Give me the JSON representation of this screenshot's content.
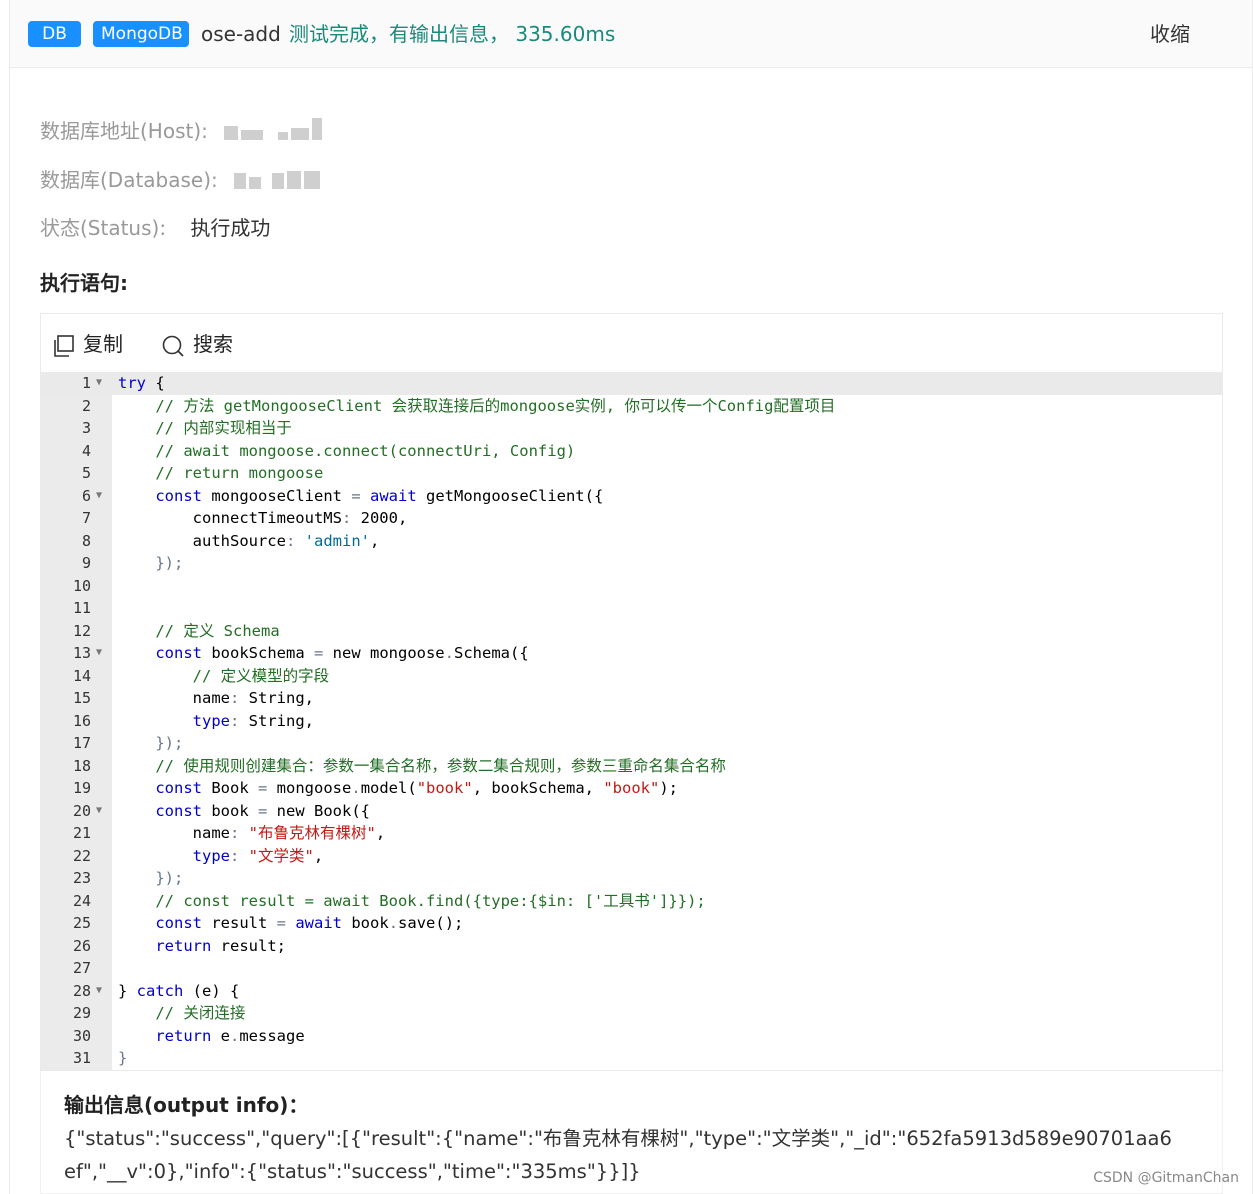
{
  "header": {
    "tag_db": "DB",
    "tag_mongo": "MongoDB",
    "name": "ose-add",
    "status_text": "测试完成，有输出信息， 335.60ms",
    "collapse": "收缩"
  },
  "info": {
    "host_label": "数据库地址(Host):",
    "db_label": "数据库(Database):",
    "status_label": "状态(Status):",
    "status_value": "执行成功"
  },
  "section_title": "执行语句:",
  "toolbar": {
    "copy": "复制",
    "search": "搜索"
  },
  "code_lines": [
    {
      "n": "1",
      "fold": true
    },
    {
      "n": "2"
    },
    {
      "n": "3"
    },
    {
      "n": "4"
    },
    {
      "n": "5"
    },
    {
      "n": "6",
      "fold": true
    },
    {
      "n": "7"
    },
    {
      "n": "8"
    },
    {
      "n": "9"
    },
    {
      "n": "10"
    },
    {
      "n": "11"
    },
    {
      "n": "12"
    },
    {
      "n": "13",
      "fold": true
    },
    {
      "n": "14"
    },
    {
      "n": "15"
    },
    {
      "n": "16"
    },
    {
      "n": "17"
    },
    {
      "n": "18"
    },
    {
      "n": "19"
    },
    {
      "n": "20",
      "fold": true
    },
    {
      "n": "21"
    },
    {
      "n": "22"
    },
    {
      "n": "23"
    },
    {
      "n": "24"
    },
    {
      "n": "25"
    },
    {
      "n": "26"
    },
    {
      "n": "27"
    },
    {
      "n": "28",
      "fold": true
    },
    {
      "n": "29"
    },
    {
      "n": "30"
    },
    {
      "n": "31"
    }
  ],
  "code": {
    "l1": [
      "try",
      " {"
    ],
    "l2": "    // 方法 getMongooseClient 会获取连接后的mongoose实例, 你可以传一个Config配置项目",
    "l3": "    // 内部实现相当于",
    "l4": "    // await mongoose.connect(connectUri, Config)",
    "l5": "    // return mongoose",
    "l6": [
      "    ",
      "const",
      " mongooseClient ",
      "=",
      " ",
      "await",
      " getMongooseClient({"
    ],
    "l7": [
      "        connectTimeoutMS",
      ":",
      " 2000,"
    ],
    "l8": [
      "        authSource",
      ":",
      " ",
      "'admin'",
      ","
    ],
    "l9": "    });",
    "l12": "    // 定义 Schema",
    "l13": [
      "    ",
      "const",
      " bookSchema ",
      "=",
      " new mongoose",
      ".",
      "Schema({"
    ],
    "l14": "        // 定义模型的字段",
    "l15": [
      "        name",
      ":",
      " String,"
    ],
    "l16": [
      "        ",
      "type",
      ":",
      " String,"
    ],
    "l17": "    });",
    "l18": "    // 使用规则创建集合：参数一集合名称，参数二集合规则，参数三重命名集合名称",
    "l19": [
      "    ",
      "const",
      " Book ",
      "=",
      " mongoose",
      ".",
      "model(",
      "\"book\"",
      ", bookSchema, ",
      "\"book\"",
      ");"
    ],
    "l20": [
      "    ",
      "const",
      " book ",
      "=",
      " new Book({"
    ],
    "l21": [
      "        name",
      ":",
      " ",
      "\"布鲁克林有棵树\"",
      ","
    ],
    "l22": [
      "        ",
      "type",
      ":",
      " ",
      "\"文学类\"",
      ","
    ],
    "l23": "    });",
    "l24": "    // const result = await Book.find({type:{$in: ['工具书']}});",
    "l25": [
      "    ",
      "const",
      " result ",
      "=",
      " ",
      "await",
      " book",
      ".",
      "save();"
    ],
    "l26": [
      "    ",
      "return",
      " result;"
    ],
    "l28": [
      "} ",
      "catch",
      " (e) {"
    ],
    "l29": "    // 关闭连接",
    "l30": [
      "    ",
      "return",
      " e",
      ".",
      "message"
    ],
    "l31": "}"
  },
  "output": {
    "title": "输出信息(output info)：",
    "body": "{\"status\":\"success\",\"query\":[{\"result\":{\"name\":\"布鲁克林有棵树\",\"type\":\"文学类\",\"_id\":\"652fa5913d589e90701aa6ef\",\"__v\":0},\"info\":{\"status\":\"success\",\"time\":\"335ms\"}}]}"
  },
  "watermark": "CSDN @GitmanChan",
  "colors": {
    "tag_blue": "#1890ff",
    "status_green": "#1a8a7a",
    "keyword_blue": "#0000cc",
    "comment_green": "#236e25",
    "string_red": "#c41a16"
  }
}
